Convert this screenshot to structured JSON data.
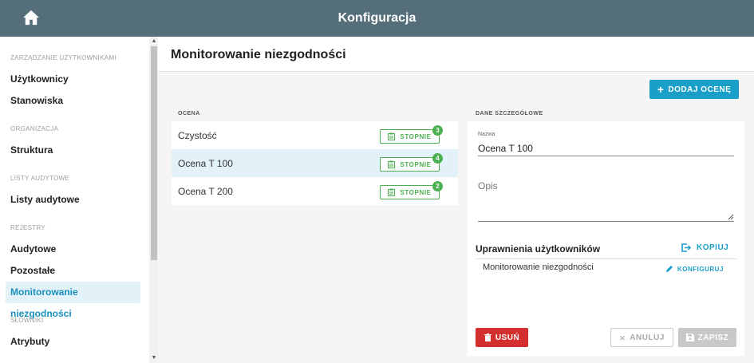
{
  "topbar": {
    "title": "Konfiguracja",
    "home_icon": "home-icon"
  },
  "sidebar": {
    "sections": [
      {
        "title": "ZARZĄDZANIE UŻYTKOWNIKAMI",
        "items": [
          "Użytkownicy",
          "Stanowiska"
        ]
      },
      {
        "title": "ORGANIZACJA",
        "items": [
          "Struktura"
        ]
      },
      {
        "title": "LISTY AUDYTOWE",
        "items": [
          "Listy audytowe"
        ]
      },
      {
        "title": "REJESTRY",
        "items": [
          "Audytowe",
          "Pozostałe",
          "Monitorowanie niezgodności"
        ]
      },
      {
        "title": "SŁOWNIKI",
        "items": [
          "Atrybuty"
        ]
      }
    ],
    "active_item": "Monitorowanie niezgodności"
  },
  "page": {
    "title": "Monitorowanie niezgodności",
    "add_button": "DODAJ OCENĘ"
  },
  "list": {
    "column_label": "OCENA",
    "grade_button_label": "STOPNIE",
    "rows": [
      {
        "name": "Czystość",
        "count": "3",
        "selected": false
      },
      {
        "name": "Ocena T 100",
        "count": "4",
        "selected": true
      },
      {
        "name": "Ocena T 200",
        "count": "2",
        "selected": false
      }
    ]
  },
  "details": {
    "column_label": "DANE SZCZEGÓŁOWE",
    "name_label": "Nazwa",
    "name_value": "Ocena T 100",
    "description_placeholder": "Opis",
    "permissions_title": "Uprawnienia użytkowników",
    "copy_button": "KOPIUJ",
    "permission_item": "Monitorowanie niezgodności",
    "configure_button": "KONFIGURUJ",
    "delete_button": "USUŃ",
    "cancel_button": "ANULUJ",
    "save_button": "ZAPISZ"
  },
  "colors": {
    "topbar": "#546e7a",
    "accent": "#1a9fc9",
    "success": "#4caf50",
    "danger": "#d32f2f",
    "selected_bg": "#e3f2f8"
  }
}
